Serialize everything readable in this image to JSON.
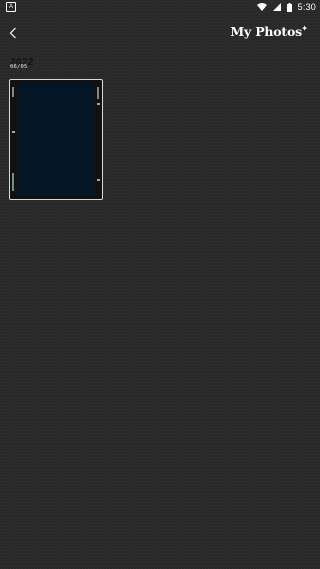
{
  "status_bar": {
    "notification_icon": "a-letter-icon",
    "time": "5:30",
    "icons": [
      "wifi-icon",
      "signal-icon",
      "battery-icon"
    ]
  },
  "header": {
    "back_icon": "chevron-left-icon",
    "title": "My Photos",
    "title_badge_icon": "sparkle-icon"
  },
  "section": {
    "label": "2022",
    "date": "06/05"
  },
  "photos": [
    {
      "thumbnail_color": "#031626"
    }
  ],
  "colors": {
    "background": "#2a2a2a",
    "text": "#ffffff",
    "thumbnail_border": "#d8d8d8",
    "thumbnail_fill": "#031626"
  }
}
